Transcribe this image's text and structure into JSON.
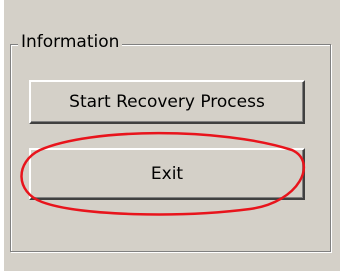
{
  "group": {
    "title": "Information"
  },
  "buttons": {
    "start_recovery_label": "Start Recovery Process",
    "exit_label": "Exit"
  },
  "annotation": {
    "color": "#e8141c"
  }
}
